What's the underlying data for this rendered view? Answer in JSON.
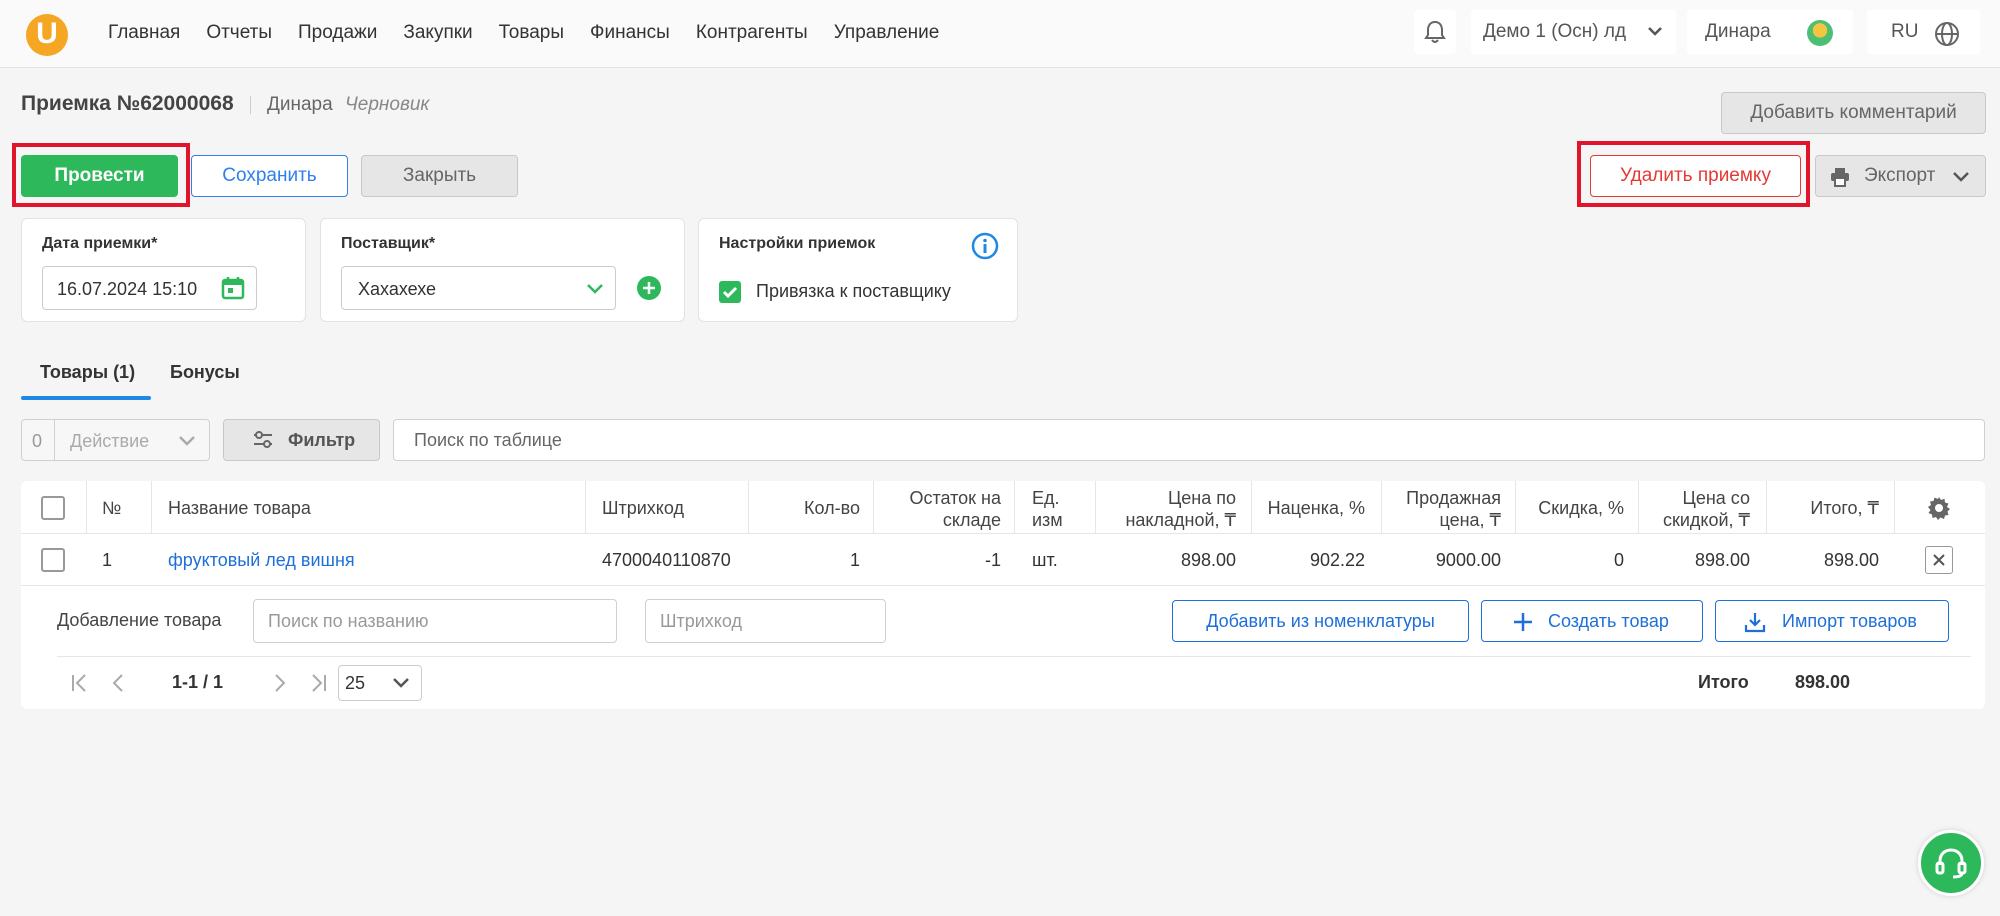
{
  "nav": {
    "logo_letter": "U",
    "items": [
      "Главная",
      "Отчеты",
      "Продажи",
      "Закупки",
      "Товары",
      "Финансы",
      "Контрагенты",
      "Управление"
    ],
    "company": "Демо 1 (Осн) лд",
    "user": "Динара",
    "lang": "RU"
  },
  "header": {
    "title": "Приемка №62000068",
    "user": "Динара",
    "status": "Черновик",
    "add_comment": "Добавить комментарий"
  },
  "actions": {
    "post": "Провести",
    "save": "Сохранить",
    "close": "Закрыть",
    "delete": "Удалить приемку",
    "export": "Экспорт"
  },
  "cards": {
    "date_label": "Дата приемки*",
    "date_value": "16.07.2024 15:10",
    "supplier_label": "Поставщик*",
    "supplier_value": "Хахахехе",
    "settings_label": "Настройки приемок",
    "link_supplier": "Привязка к поставщику",
    "link_supplier_checked": true
  },
  "tabs": [
    "Товары (1)",
    "Бонусы"
  ],
  "toolbar": {
    "selected_count": "0",
    "action": "Действие",
    "filter": "Фильтр",
    "search_placeholder": "Поиск по таблице"
  },
  "table": {
    "headers": {
      "num": "№",
      "name": "Название товара",
      "barcode": "Штрихкод",
      "qty": "Кол-во",
      "stock_1": "Остаток на",
      "stock_2": "складе",
      "unit_1": "Ед.",
      "unit_2": "изм",
      "price_1": "Цена по",
      "price_2": "накладной, ₸",
      "markup": "Наценка, %",
      "sell_1": "Продажная",
      "sell_2": "цена, ₸",
      "discount": "Скидка, %",
      "disc_price_1": "Цена со",
      "disc_price_2": "скидкой, ₸",
      "total": "Итого, ₸"
    },
    "rows": [
      {
        "num": "1",
        "name": "фруктовый лед вишня",
        "barcode": "4700040110870",
        "qty": "1",
        "stock": "-1",
        "unit": "шт.",
        "price": "898.00",
        "markup": "902.22",
        "sell_price": "9000.00",
        "discount": "0",
        "disc_price": "898.00",
        "total": "898.00"
      }
    ]
  },
  "add_product": {
    "label": "Добавление товара",
    "name_placeholder": "Поиск по названию",
    "barcode_placeholder": "Штрихкод",
    "from_catalog": "Добавить из номенклатуры",
    "create": "Создать товар",
    "import": "Импорт товаров"
  },
  "pager": {
    "range": "1-1 / 1",
    "per_page": "25",
    "total_label": "Итого",
    "total_value": "898.00"
  },
  "colors": {
    "primary_green": "#2eb85c",
    "primary_blue": "#1e6fd9",
    "danger_red": "#e53935",
    "highlight_red": "#e0142a",
    "logo_orange": "#f5a623"
  }
}
